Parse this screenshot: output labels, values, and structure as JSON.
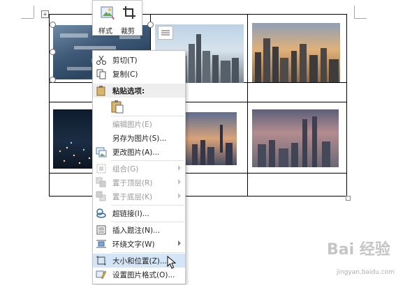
{
  "toolbar": {
    "style_label": "样式",
    "crop_label": "裁剪"
  },
  "context_menu": {
    "cut": "剪切(T)",
    "copy": "复制(C)",
    "paste_options": "粘贴选项:",
    "edit_picture": "编辑图片(E)",
    "save_as_picture": "另存为图片(S)...",
    "change_picture": "更改图片(A)...",
    "group": "组合(G)",
    "bring_to_front": "置于顶层(R)",
    "send_to_back": "置于底层(K)",
    "hyperlink": "超链接(I)...",
    "insert_caption": "插入题注(N)...",
    "wrap_text": "环绕文字(W)",
    "size_and_position": "大小和位置(Z)...",
    "format_picture": "设置图片格式(O)..."
  },
  "watermark": {
    "brand": "Bai 经验",
    "url": "jingyan.baidu.com"
  }
}
